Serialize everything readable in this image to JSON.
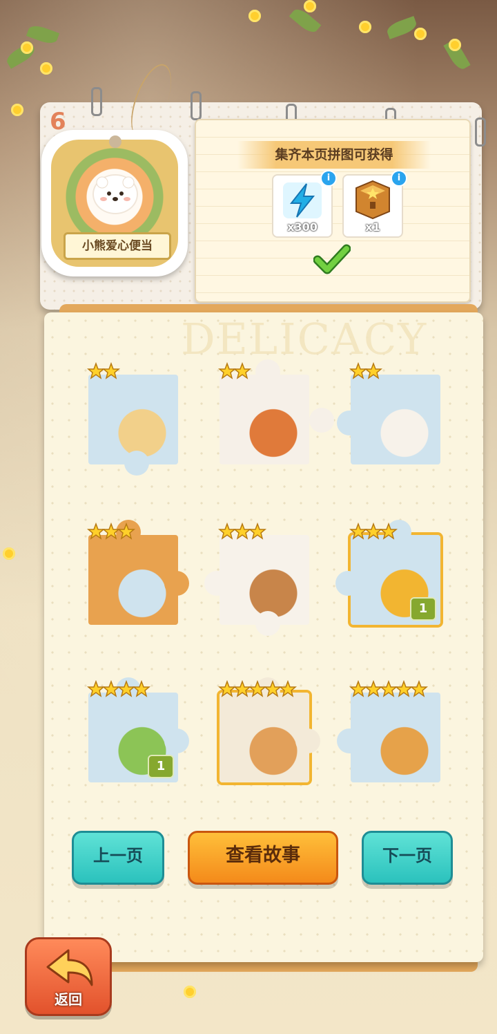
{
  "page": {
    "number": "6"
  },
  "album": {
    "title": "小熊爱心便当",
    "watermark": "DELICACY"
  },
  "reward": {
    "title": "集齐本页拼图可获得",
    "items": [
      {
        "icon": "lightning-icon",
        "qty": "x300"
      },
      {
        "icon": "treasure-chest-icon",
        "qty": "x1"
      }
    ],
    "status": "check-icon"
  },
  "pieces": [
    {
      "stars": 2,
      "count": ""
    },
    {
      "stars": 2,
      "count": ""
    },
    {
      "stars": 2,
      "count": ""
    },
    {
      "stars": 3,
      "count": ""
    },
    {
      "stars": 3,
      "count": ""
    },
    {
      "stars": 3,
      "count": "1"
    },
    {
      "stars": 4,
      "count": "1"
    },
    {
      "stars": 5,
      "count": ""
    },
    {
      "stars": 5,
      "count": ""
    }
  ],
  "buttons": {
    "prev": "上一页",
    "story": "查看故事",
    "next": "下一页",
    "back": "返回"
  },
  "colors": {
    "star": "#ffd02a",
    "teal": "#2bc2bd",
    "orange": "#f48a1a",
    "badge": "#86a82f"
  }
}
